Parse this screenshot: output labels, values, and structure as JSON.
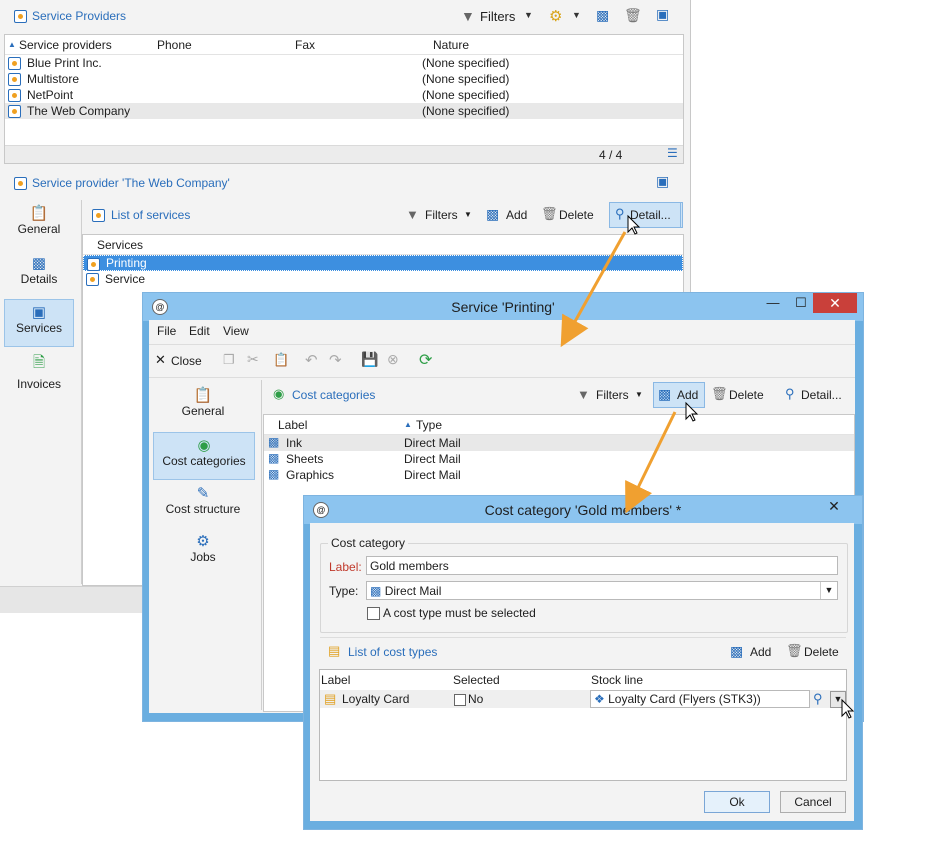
{
  "providers": {
    "title": "Service Providers",
    "filters_label": "Filters",
    "columns": [
      "Service providers",
      "Phone",
      "Fax",
      "Nature"
    ],
    "rows": [
      {
        "name": "Blue Print Inc.",
        "nature": "(None specified)"
      },
      {
        "name": "Multistore",
        "nature": "(None specified)"
      },
      {
        "name": "NetPoint",
        "nature": "(None specified)"
      },
      {
        "name": "The Web Company",
        "nature": "(None specified)"
      }
    ],
    "count": "4 / 4"
  },
  "provider_detail": {
    "title": "Service provider 'The Web Company'",
    "nav": [
      "General",
      "Details",
      "Services",
      "Invoices"
    ],
    "services_title": "List of services",
    "filters_label": "Filters",
    "add_label": "Add",
    "delete_label": "Delete",
    "detail_label": "Detail...",
    "column": "Services",
    "rows": [
      "Printing",
      "Service"
    ]
  },
  "service_window": {
    "title": "Service 'Printing'",
    "menu": [
      "File",
      "Edit",
      "View"
    ],
    "close_label": "Close",
    "nav": [
      "General",
      "Cost categories",
      "Cost structure",
      "Jobs"
    ],
    "section_title": "Cost categories",
    "filters_label": "Filters",
    "add_label": "Add",
    "delete_label": "Delete",
    "detail_label": "Detail...",
    "columns": [
      "Label",
      "Type"
    ],
    "rows": [
      {
        "label": "Ink",
        "type": "Direct Mail"
      },
      {
        "label": "Sheets",
        "type": "Direct Mail"
      },
      {
        "label": "Graphics",
        "type": "Direct Mail"
      }
    ]
  },
  "cost_window": {
    "title": "Cost category 'Gold members' *",
    "group_label": "Cost category",
    "label_caption": "Label:",
    "label_value": "Gold members",
    "type_caption": "Type:",
    "type_value": "Direct Mail",
    "checkbox_label": "A cost type must be selected",
    "list_title": "List of cost types",
    "add_label": "Add",
    "delete_label": "Delete",
    "columns": [
      "Label",
      "Selected",
      "Stock line"
    ],
    "row": {
      "label": "Loyalty Card",
      "selected": "No",
      "stock_line": "Loyalty Card (Flyers (STK3))"
    },
    "ok_label": "Ok",
    "cancel_label": "Cancel"
  },
  "colors": {
    "accent": "#2a6ebb",
    "arrow": "#f0a030",
    "selection": "#3d8fe0",
    "titlebar": "#8cc4ef",
    "close": "#c9403a"
  }
}
